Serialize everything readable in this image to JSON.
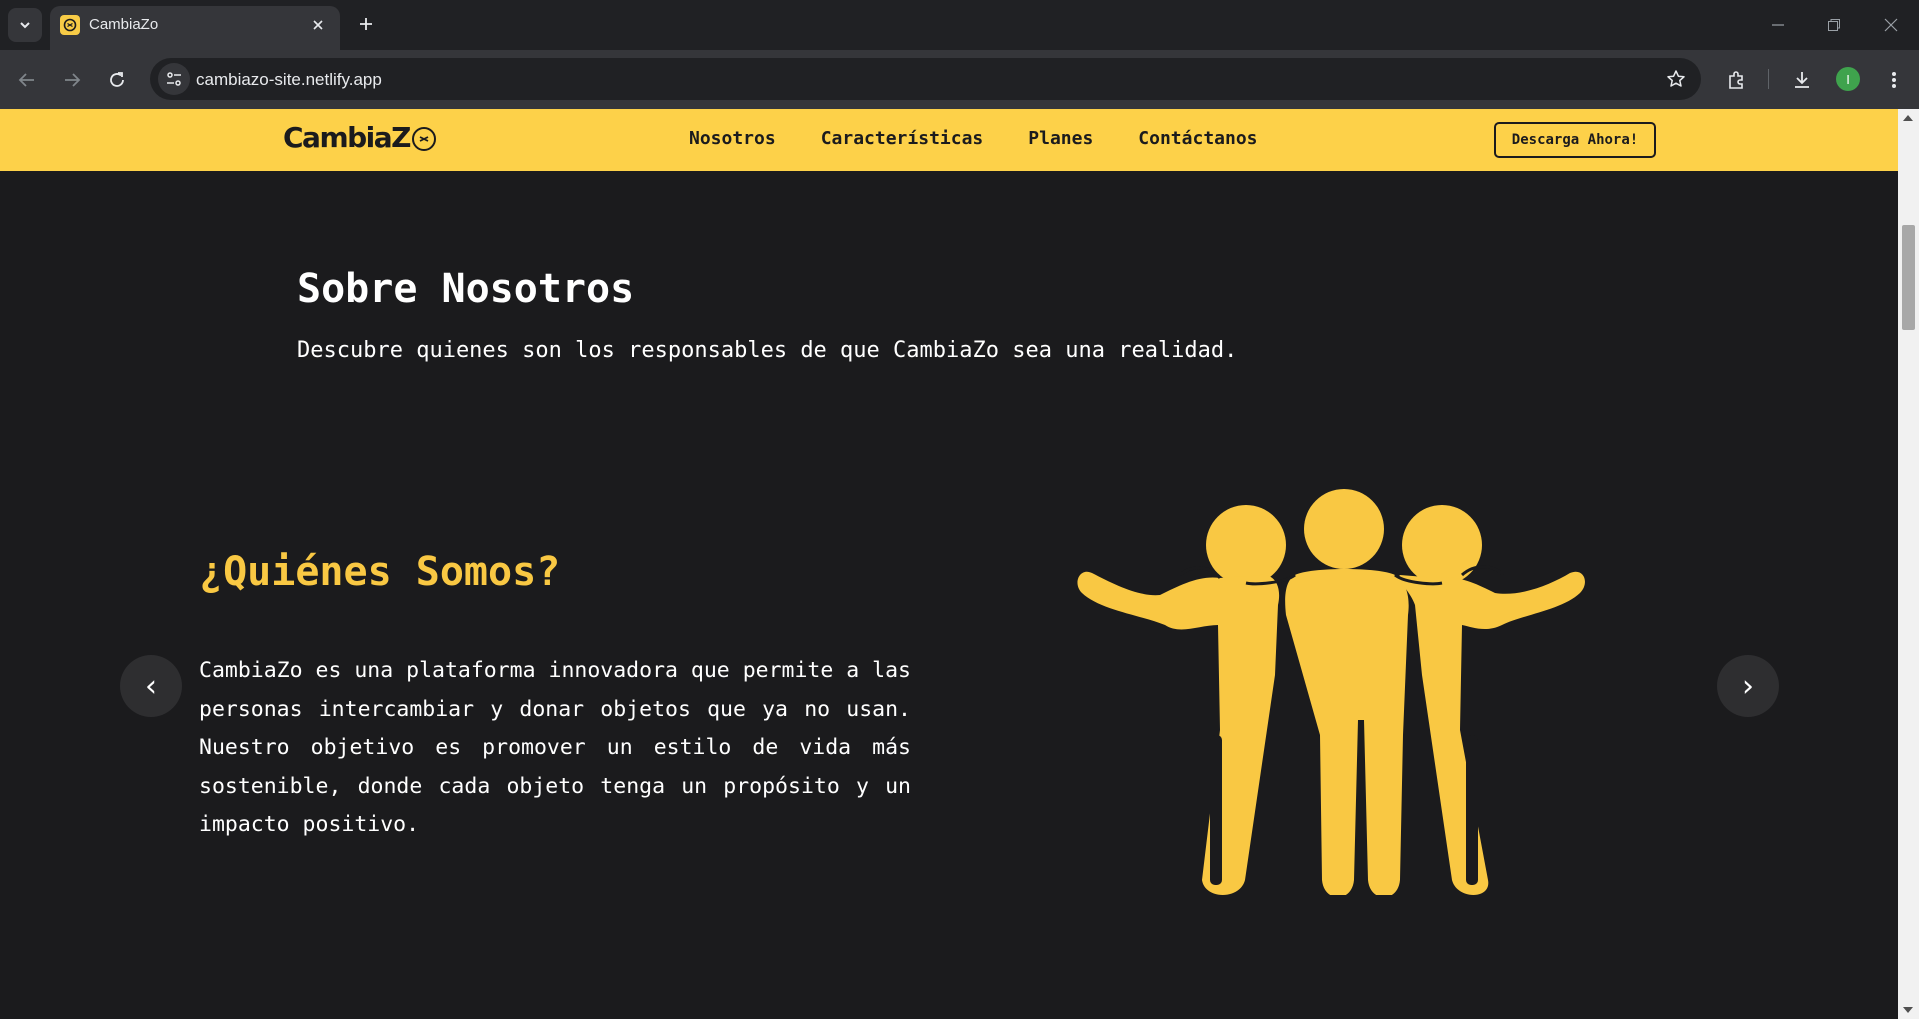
{
  "browser": {
    "tab_title": "CambiaZo",
    "url": "cambiazo-site.netlify.app",
    "profile_initial": "I"
  },
  "site": {
    "logo_text": "CambiaZ",
    "nav": [
      "Nosotros",
      "Características",
      "Planes",
      "Contáctanos"
    ],
    "download_label": "Descarga Ahora!"
  },
  "about": {
    "title": "Sobre Nosotros",
    "subtitle": "Descubre quienes son los responsables de que CambiaZo sea una realidad."
  },
  "slide": {
    "title": "¿Quiénes Somos?",
    "text": "CambiaZo es una plataforma innovadora que permite a las personas intercambiar y donar objetos que ya no usan. Nuestro objetivo es promover un estilo de vida más sostenible, donde cada objeto tenga un propósito y un impacto positivo.",
    "prev_label": "‹",
    "next_label": "›"
  },
  "colors": {
    "brand_yellow": "#fdd149",
    "page_bg": "#1b1b1d",
    "accent_title": "#f9c843"
  },
  "icons": [
    "tab-search-icon",
    "favicon-icon",
    "close-icon",
    "new-tab-icon",
    "minimize-icon",
    "restore-icon",
    "window-close-icon",
    "back-icon",
    "forward-icon",
    "reload-icon",
    "site-info-icon",
    "bookmark-star-icon",
    "extensions-icon",
    "download-icon",
    "menu-icon",
    "team-illustration"
  ]
}
